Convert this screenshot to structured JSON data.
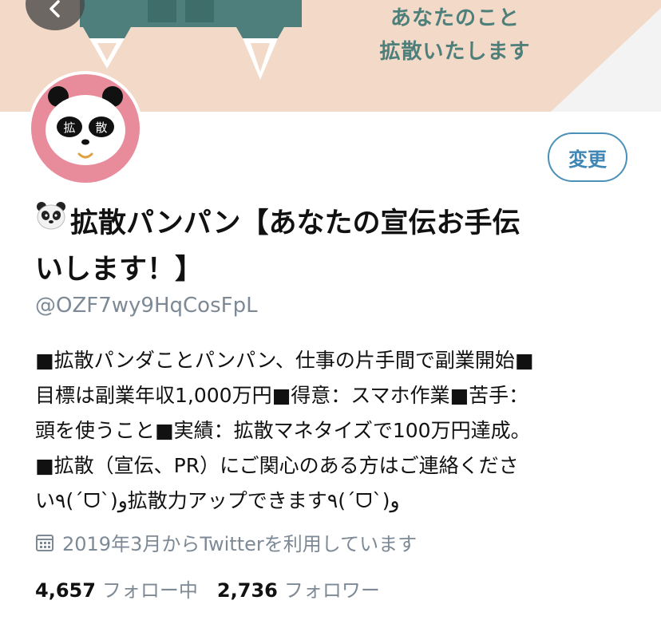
{
  "banner": {
    "text_line1": "あなたのこと",
    "text_line2": "拡散いたします"
  },
  "avatar": {
    "eye_left_text": "拡",
    "eye_right_text": "散"
  },
  "edit_button_label": "変更",
  "profile": {
    "name_emoji": "panda-face-icon",
    "name_line1": "拡散パンパン【あなたの宣伝お手伝",
    "name_line2": "いします！】",
    "handle": "@OZF7wy9HqCosFpL"
  },
  "bio": {
    "lines": [
      "■拡散パンダことパンパン、仕事の片手間で副業開始■",
      "目標は副業年収1,000万円■得意：スマホ作業■苦手：",
      "頭を使うこと■実績：拡散マネタイズで100万円達成。",
      "■拡散（宣伝、PR）にご関心のある方はご連絡くださ",
      "い٩(ˊᗜˋ)و拡散力アップできます٩(ˊᗜˋ)و"
    ]
  },
  "joined": {
    "icon": "calendar-icon",
    "text": "2019年3月からTwitterを利用しています"
  },
  "stats": {
    "following_count": "4,657",
    "following_label": "フォロー中",
    "followers_count": "2,736",
    "followers_label": "フォロワー"
  },
  "colors": {
    "banner_peach": "#f3d9c7",
    "banner_teal": "#4f7f7c",
    "avatar_pink": "#e88b9b",
    "accent_blue": "#3f86b5",
    "secondary_text": "#7d8a96"
  }
}
